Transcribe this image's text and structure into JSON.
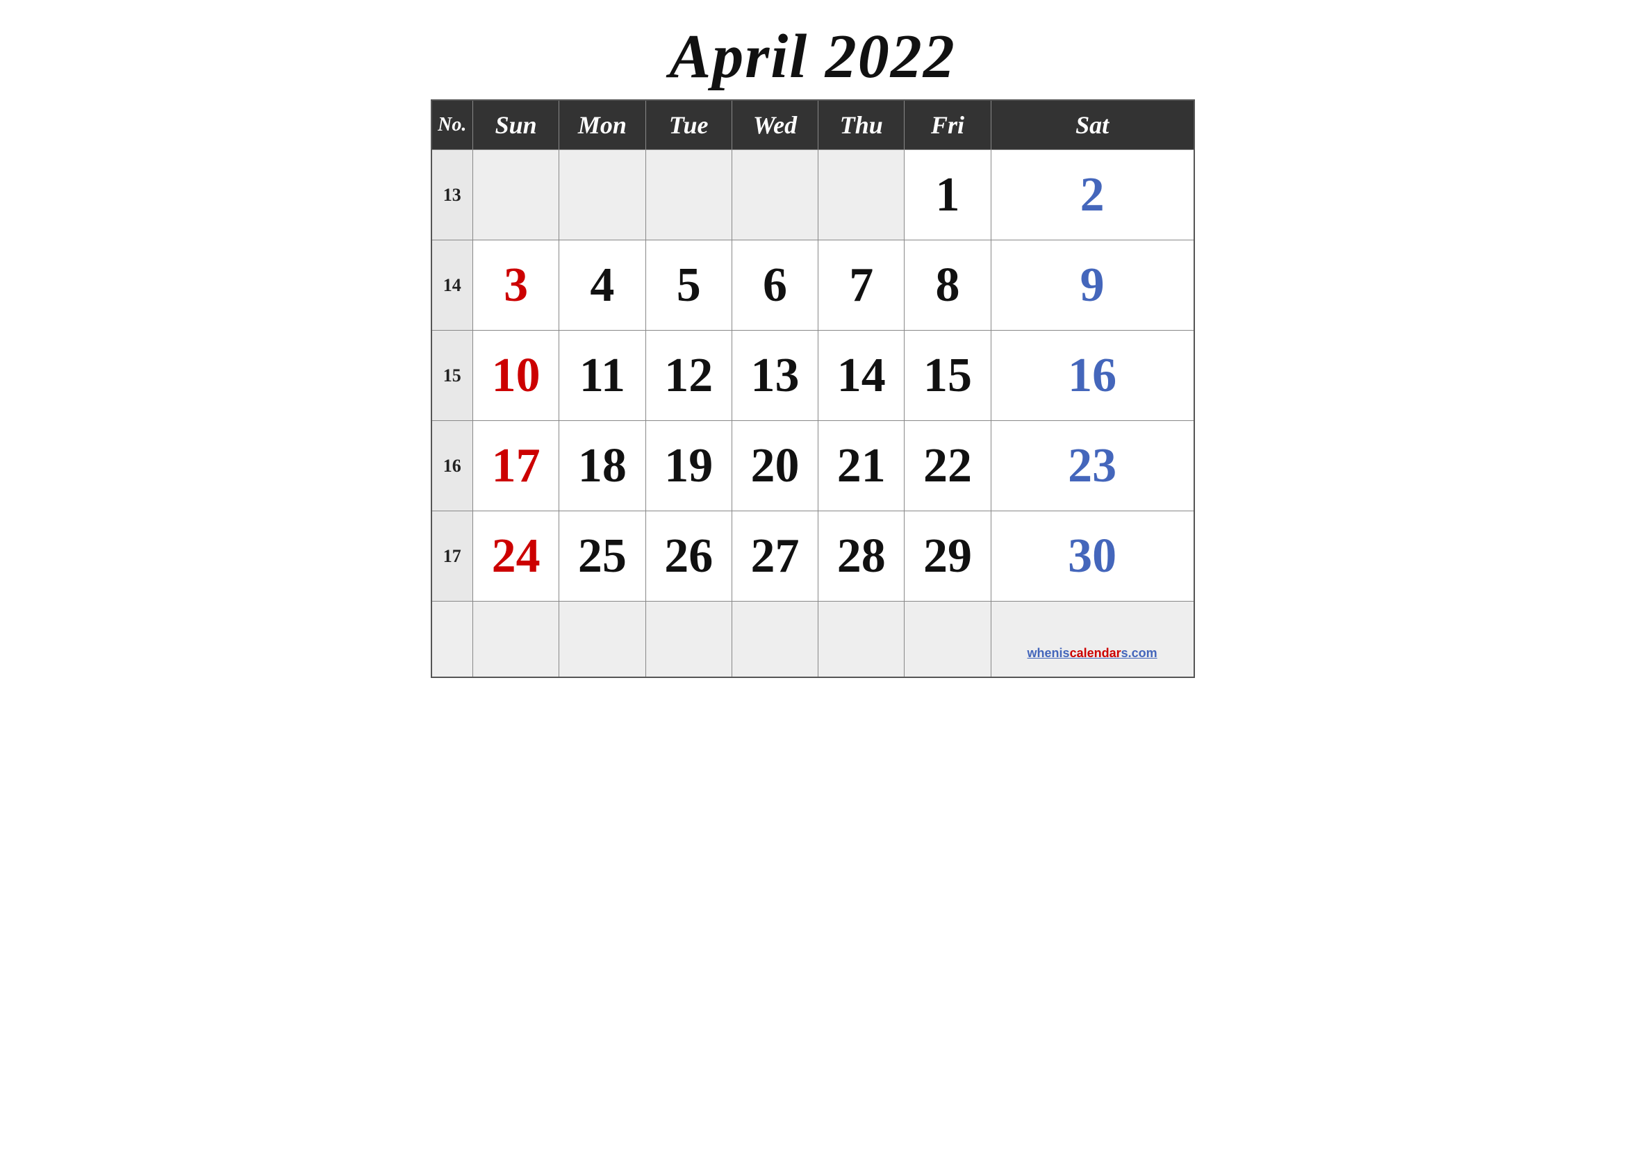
{
  "title": "April 2022",
  "header": {
    "no_label": "No.",
    "days": [
      "Sun",
      "Mon",
      "Tue",
      "Wed",
      "Thu",
      "Fri",
      "Sat"
    ]
  },
  "weeks": [
    {
      "week_no": "13",
      "days": [
        {
          "date": "",
          "color": "empty"
        },
        {
          "date": "",
          "color": "empty"
        },
        {
          "date": "",
          "color": "empty"
        },
        {
          "date": "",
          "color": "empty"
        },
        {
          "date": "",
          "color": "empty"
        },
        {
          "date": "1",
          "color": "black"
        },
        {
          "date": "2",
          "color": "blue"
        }
      ]
    },
    {
      "week_no": "14",
      "days": [
        {
          "date": "3",
          "color": "red"
        },
        {
          "date": "4",
          "color": "black"
        },
        {
          "date": "5",
          "color": "black"
        },
        {
          "date": "6",
          "color": "black"
        },
        {
          "date": "7",
          "color": "black"
        },
        {
          "date": "8",
          "color": "black"
        },
        {
          "date": "9",
          "color": "blue"
        }
      ]
    },
    {
      "week_no": "15",
      "days": [
        {
          "date": "10",
          "color": "red"
        },
        {
          "date": "11",
          "color": "black"
        },
        {
          "date": "12",
          "color": "black"
        },
        {
          "date": "13",
          "color": "black"
        },
        {
          "date": "14",
          "color": "black"
        },
        {
          "date": "15",
          "color": "black"
        },
        {
          "date": "16",
          "color": "blue"
        }
      ]
    },
    {
      "week_no": "16",
      "days": [
        {
          "date": "17",
          "color": "red"
        },
        {
          "date": "18",
          "color": "black"
        },
        {
          "date": "19",
          "color": "black"
        },
        {
          "date": "20",
          "color": "black"
        },
        {
          "date": "21",
          "color": "black"
        },
        {
          "date": "22",
          "color": "black"
        },
        {
          "date": "23",
          "color": "blue"
        }
      ]
    },
    {
      "week_no": "17",
      "days": [
        {
          "date": "24",
          "color": "red"
        },
        {
          "date": "25",
          "color": "black"
        },
        {
          "date": "26",
          "color": "black"
        },
        {
          "date": "27",
          "color": "black"
        },
        {
          "date": "28",
          "color": "black"
        },
        {
          "date": "29",
          "color": "black"
        },
        {
          "date": "30",
          "color": "blue"
        }
      ]
    }
  ],
  "watermark": {
    "text_before": "whenis",
    "text_highlight": "calendar",
    "text_after": "s.com",
    "url": "https://wheniscalendars.com"
  }
}
